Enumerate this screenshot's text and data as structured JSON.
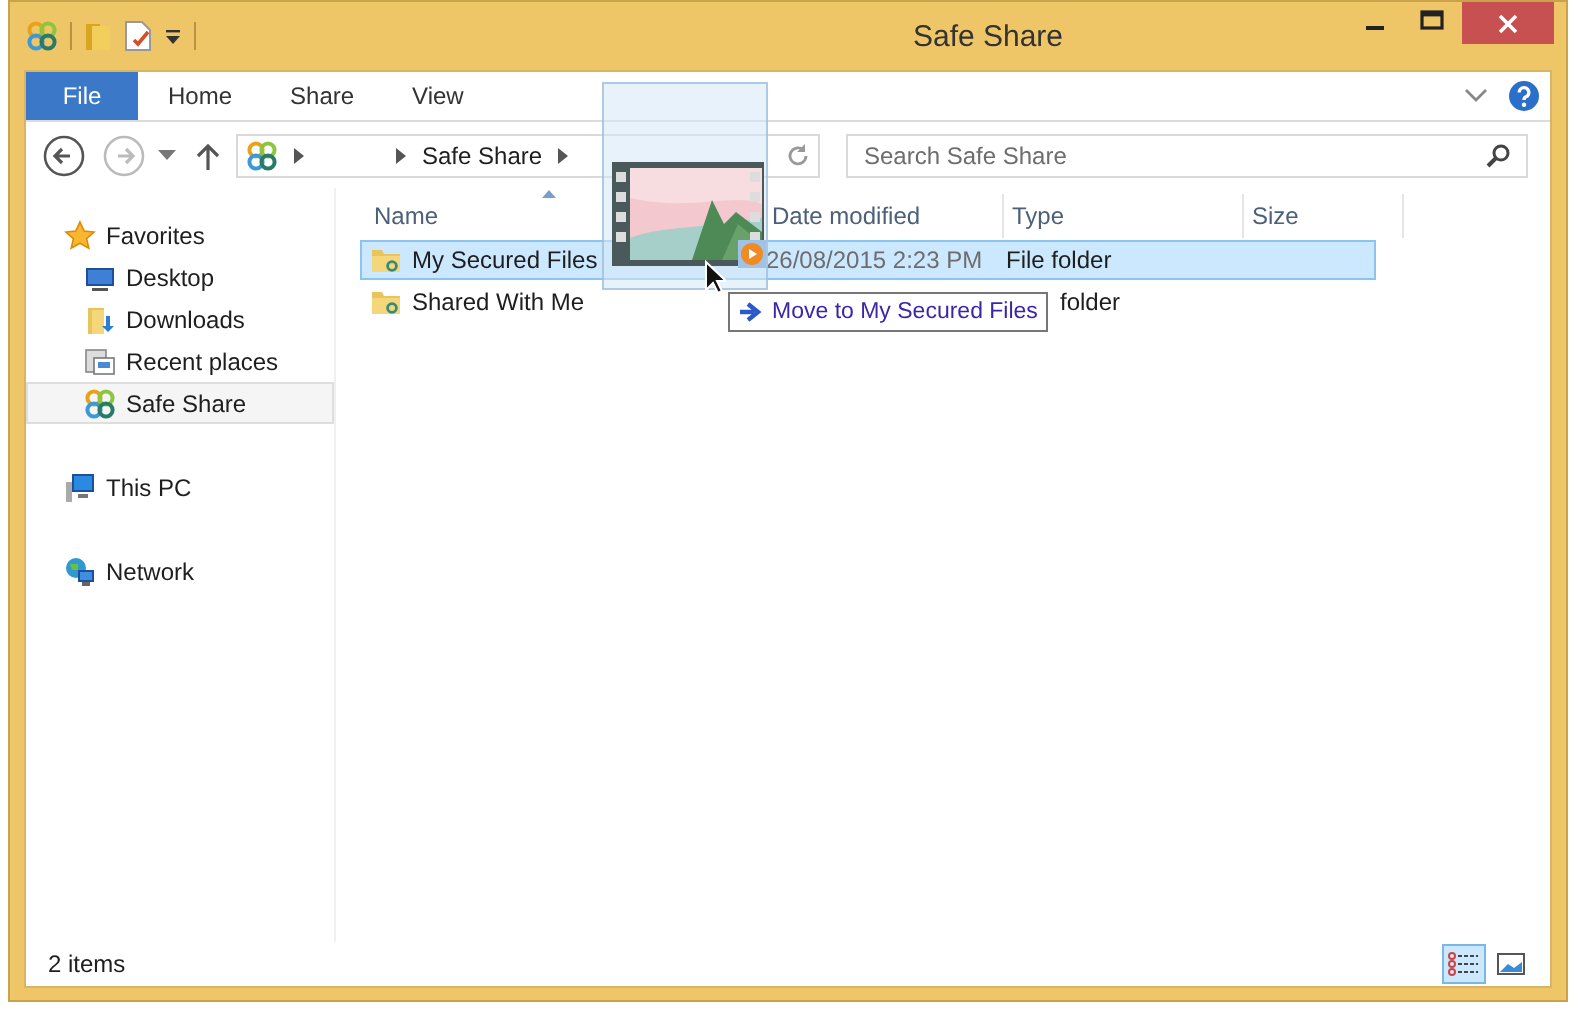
{
  "window": {
    "title": "Safe Share"
  },
  "ribbon_tabs": [
    {
      "label": "File",
      "kind": "file"
    },
    {
      "label": "Home",
      "kind": "tab"
    },
    {
      "label": "Share",
      "kind": "tab"
    },
    {
      "label": "View",
      "kind": "tab"
    }
  ],
  "nav_buttons": [
    {
      "kind": "back",
      "disabled": false
    },
    {
      "kind": "forward",
      "disabled": true
    }
  ],
  "address_bar": {
    "path": [
      "Safe Share"
    ]
  },
  "search": {
    "placeholder": "Search Safe Share"
  },
  "sidebar": {
    "groups": [
      {
        "label": "Favorites",
        "kind": "favorites",
        "selected": false,
        "children": [
          {
            "label": "Desktop",
            "kind": "desktop",
            "selected": false
          },
          {
            "label": "Downloads",
            "kind": "downloads",
            "selected": false
          },
          {
            "label": "Recent places",
            "kind": "recent",
            "selected": false
          },
          {
            "label": "Safe Share",
            "kind": "safeshare",
            "selected": true
          }
        ]
      },
      {
        "label": "This PC",
        "kind": "pc",
        "selected": false
      },
      {
        "label": "Network",
        "kind": "network",
        "selected": false
      }
    ]
  },
  "file_list": {
    "columns": [
      {
        "label": "Name",
        "sorted": true
      },
      {
        "label": "Date modified",
        "sorted": false
      },
      {
        "label": "Type",
        "sorted": false
      },
      {
        "label": "Size",
        "sorted": false
      }
    ],
    "rows": [
      {
        "name": "My Secured Files",
        "date": "26/08/2015 2:23 PM",
        "type": "File folder",
        "selected": true
      },
      {
        "name": "Shared With Me",
        "type": "folder",
        "selected": false
      }
    ]
  },
  "drag": {
    "tooltip": "Move to My Secured Files"
  },
  "status_bar": {
    "item_count": "2 items",
    "views": [
      {
        "kind": "details",
        "selected": true
      },
      {
        "kind": "large_icons",
        "selected": false
      }
    ]
  }
}
